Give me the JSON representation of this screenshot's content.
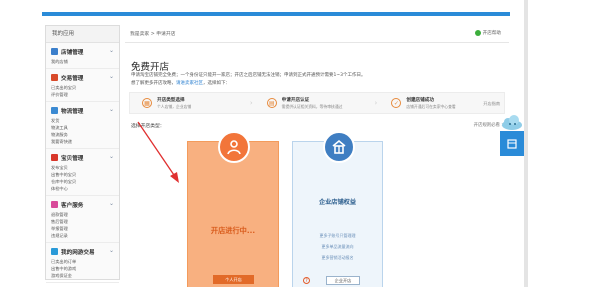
{
  "sidebar": {
    "header": "我的应用",
    "groups": [
      {
        "title": "店铺管理",
        "icon": "shop-icon",
        "color": "#3b7fcb",
        "links": [
          "我的店铺"
        ]
      },
      {
        "title": "交易管理",
        "icon": "trade-icon",
        "color": "#d84a2a",
        "links": [
          "已卖出的宝贝",
          "评价管理"
        ]
      },
      {
        "title": "物流管理",
        "icon": "logistics-icon",
        "color": "#3b8ad2",
        "links": [
          "发货",
          "物流工具",
          "物流服务",
          "我要寄快递"
        ]
      },
      {
        "title": "宝贝管理",
        "icon": "goods-icon",
        "color": "#d8362a",
        "links": [
          "发布宝贝",
          "出售中的宝贝",
          "仓库中的宝贝",
          "体检中心"
        ]
      },
      {
        "title": "客户服务",
        "icon": "service-icon",
        "color": "#d84a9a",
        "links": [
          "退款管理",
          "售后管理",
          "举报管理",
          "违规记录"
        ]
      },
      {
        "title": "我的网游交易",
        "icon": "game-icon",
        "color": "#2a9ad8",
        "links": [
          "已卖出的订单",
          "出售中的游戏",
          "游戏保证金"
        ]
      }
    ]
  },
  "main": {
    "breadcrumb": "我是卖家 > 申请开店",
    "help_label": "开店帮助",
    "title": "免费开店",
    "desc1": "申请淘宝店铺完全免费；一个身份证只能开一家店；开店之后店铺无法注销；申请到正式开通预计需要1~3个工作日。",
    "desc2_prefix": "想了解更多开店攻略，",
    "desc2_link": "请进卖家社区",
    "desc2_suffix": "，选择如下：",
    "steps": [
      {
        "title": "开店类型选择",
        "sub": "个人店铺，企业店铺",
        "icon": "shop-type-icon",
        "glyph": "▦"
      },
      {
        "title": "申请开店认证",
        "sub": "需提供认证相关资料，等待审核通过",
        "icon": "certify-icon",
        "glyph": "▤"
      },
      {
        "title": "创建店铺成功",
        "sub": "店铺开通后可在卖家中心查看",
        "icon": "success-icon",
        "glyph": "✓"
      }
    ],
    "steps_note": "开店指南",
    "select_label": "选择开店类型：",
    "faq": "开店规则必看 >",
    "personal": {
      "status": "开店进行中...",
      "button": "个人开店"
    },
    "enterprise": {
      "title": "企业店铺权益",
      "links": [
        "更多子账号只管理理",
        "更多单品流量流向",
        "更多营销活动报名"
      ],
      "help": "?",
      "button": "企业开店"
    }
  },
  "colors": {
    "accent": "#2a8bd8",
    "personal_card": "#f8b080",
    "personal_badge": "#f2753a",
    "enterprise_badge": "#3f7ec2",
    "arrow": "#e03030"
  }
}
